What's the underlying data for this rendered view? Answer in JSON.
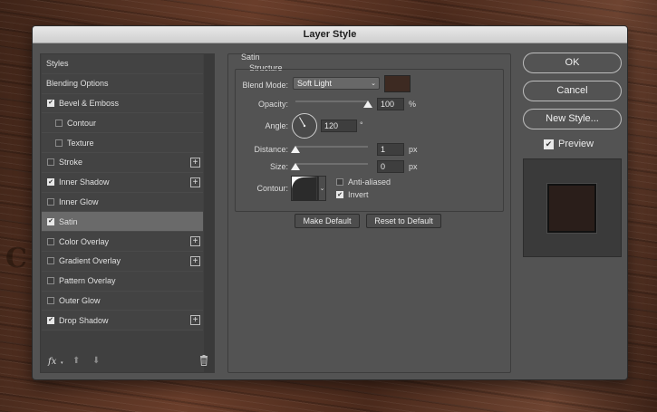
{
  "window": {
    "title": "Layer Style"
  },
  "styles_list": {
    "items": [
      {
        "label": "Styles",
        "checkbox": false,
        "checked": false,
        "plus": false,
        "indent": 0,
        "selected": false
      },
      {
        "label": "Blending Options",
        "checkbox": false,
        "checked": false,
        "plus": false,
        "indent": 0,
        "selected": false
      },
      {
        "label": "Bevel & Emboss",
        "checkbox": true,
        "checked": true,
        "plus": false,
        "indent": 1,
        "selected": false
      },
      {
        "label": "Contour",
        "checkbox": true,
        "checked": false,
        "plus": false,
        "indent": 2,
        "selected": false
      },
      {
        "label": "Texture",
        "checkbox": true,
        "checked": false,
        "plus": false,
        "indent": 2,
        "selected": false
      },
      {
        "label": "Stroke",
        "checkbox": true,
        "checked": false,
        "plus": true,
        "indent": 1,
        "selected": false
      },
      {
        "label": "Inner Shadow",
        "checkbox": true,
        "checked": true,
        "plus": true,
        "indent": 1,
        "selected": false
      },
      {
        "label": "Inner Glow",
        "checkbox": true,
        "checked": false,
        "plus": false,
        "indent": 1,
        "selected": false
      },
      {
        "label": "Satin",
        "checkbox": true,
        "checked": true,
        "plus": false,
        "indent": 1,
        "selected": true
      },
      {
        "label": "Color Overlay",
        "checkbox": true,
        "checked": false,
        "plus": true,
        "indent": 1,
        "selected": false
      },
      {
        "label": "Gradient Overlay",
        "checkbox": true,
        "checked": false,
        "plus": true,
        "indent": 1,
        "selected": false
      },
      {
        "label": "Pattern Overlay",
        "checkbox": true,
        "checked": false,
        "plus": false,
        "indent": 1,
        "selected": false
      },
      {
        "label": "Outer Glow",
        "checkbox": true,
        "checked": false,
        "plus": false,
        "indent": 1,
        "selected": false
      },
      {
        "label": "Drop Shadow",
        "checkbox": true,
        "checked": true,
        "plus": true,
        "indent": 1,
        "selected": false
      }
    ],
    "bottom": {
      "fx_label": "fx"
    }
  },
  "satin": {
    "section_title": "Satin",
    "group_title": "Structure",
    "blend_mode": {
      "label": "Blend Mode:",
      "value": "Soft Light",
      "swatch_color": "#3d2a22"
    },
    "opacity": {
      "label": "Opacity:",
      "value": "100",
      "unit": "%",
      "fraction": 1.0
    },
    "angle": {
      "label": "Angle:",
      "value": "120",
      "unit": "°",
      "degrees": 120
    },
    "distance": {
      "label": "Distance:",
      "value": "1",
      "unit": "px",
      "fraction": 0.0
    },
    "size": {
      "label": "Size:",
      "value": "0",
      "unit": "px",
      "fraction": 0.0
    },
    "contour": {
      "label": "Contour:"
    },
    "anti_aliased": {
      "label": "Anti-aliased",
      "checked": false
    },
    "invert": {
      "label": "Invert",
      "checked": true
    },
    "make_default": "Make Default",
    "reset_default": "Reset to Default"
  },
  "actions": {
    "ok": "OK",
    "cancel": "Cancel",
    "new_style": "New Style...",
    "preview_label": "Preview",
    "preview_checked": true
  },
  "colors": {
    "dialog_bg": "#535353",
    "selected_row": "#6a6a6a",
    "preview_swatch": "#2a1e1a"
  }
}
